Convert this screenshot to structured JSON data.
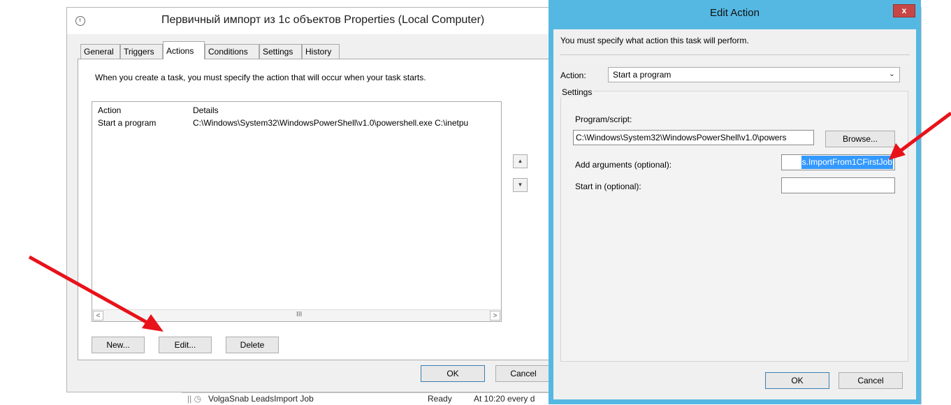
{
  "background_list": {
    "row_name": "VolgaSnab LeadsImport Job",
    "row_status": "Ready",
    "row_trigger": "At 10:20 every d"
  },
  "properties_dialog": {
    "title": "Первичный импорт из 1с объектов Properties (Local Computer)",
    "tabs": [
      {
        "label": "General"
      },
      {
        "label": "Triggers"
      },
      {
        "label": "Actions",
        "active": true
      },
      {
        "label": "Conditions"
      },
      {
        "label": "Settings"
      },
      {
        "label": "History"
      }
    ],
    "intro_text": "When you create a task, you must specify the action that will occur when your task starts.",
    "list": {
      "columns": [
        "Action",
        "Details"
      ],
      "rows": [
        {
          "action": "Start a program",
          "details": "C:\\Windows\\System32\\WindowsPowerShell\\v1.0\\powershell.exe C:\\inetpu"
        }
      ],
      "grip": "III"
    },
    "buttons": {
      "new": "New...",
      "edit": "Edit...",
      "delete": "Delete",
      "ok": "OK",
      "cancel": "Cancel"
    }
  },
  "edit_action_dialog": {
    "title": "Edit Action",
    "close_glyph": "x",
    "intro_text": "You must specify what action this task will perform.",
    "action_label": "Action:",
    "action_value": "Start a program",
    "settings_label": "Settings",
    "program_label": "Program/script:",
    "program_value": "C:\\Windows\\System32\\WindowsPowerShell\\v1.0\\powers",
    "browse_label": "Browse...",
    "args_label": "Add arguments (optional):",
    "args_value": "s.ImportFrom1CFirstJob",
    "start_in_label": "Start in (optional):",
    "start_in_value": "",
    "ok_label": "OK",
    "cancel_label": "Cancel"
  },
  "colors": {
    "dialog_frame": "#55b8e2",
    "close_button": "#c74646",
    "selection": "#3399ff",
    "annotation_arrow": "#e8121a"
  },
  "icons": [
    "clock-icon",
    "scroll-up-icon",
    "scroll-down-icon",
    "chevron-down-icon",
    "close-icon",
    "annotation-arrow"
  ]
}
